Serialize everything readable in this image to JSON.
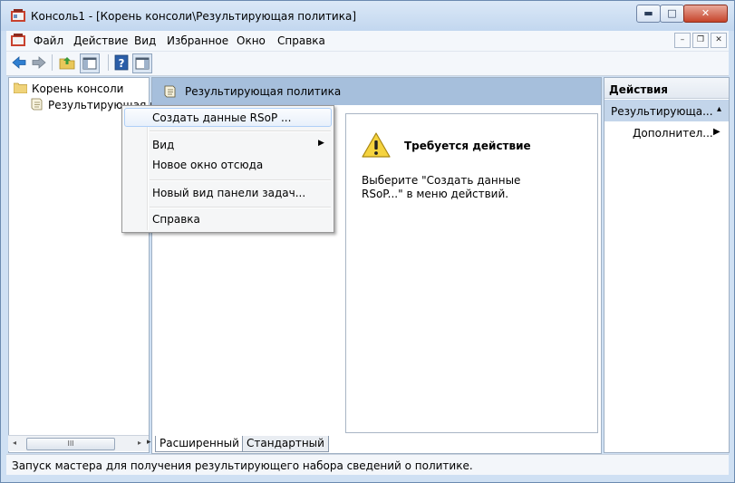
{
  "window": {
    "title": "Консоль1 - [Корень консоли\\Результирующая политика]",
    "minimize": "▬",
    "maximize": "□",
    "close": "✕"
  },
  "menu": {
    "items": [
      "Файл",
      "Действие",
      "Вид",
      "Избранное",
      "Окно",
      "Справка"
    ],
    "mdi_min": "–",
    "mdi_restore": "❐",
    "mdi_close": "✕"
  },
  "toolbar": {
    "icons": [
      "back-icon",
      "forward-icon",
      "up-folder-icon",
      "show-hide-tree-icon",
      "help-icon",
      "show-hide-action-pane-icon"
    ]
  },
  "tree": {
    "root": "Корень консоли",
    "child": "Результирующая п"
  },
  "scroll": {
    "thumb": "III",
    "left": "◂",
    "right": "▸"
  },
  "center": {
    "header": "Результирующая политика",
    "warning_title": "Требуется действие",
    "warning_text": "Выберите \"Создать данные RSoP...\" в меню действий."
  },
  "tabs": {
    "extended": "Расширенный",
    "standard": "Стандартный",
    "arrow": "▸"
  },
  "actions": {
    "header": "Действия",
    "section": "Результирующа...",
    "section_arrow": "▴",
    "more": "Дополнител...",
    "more_arrow": "▶"
  },
  "context_menu": {
    "create_rsop": "Создать данные RSoP ...",
    "view": "Вид",
    "view_arrow": "▶",
    "new_window": "Новое окно отсюда",
    "new_taskpad": "Новый вид панели задач...",
    "help": "Справка"
  },
  "status": {
    "text": "Запуск мастера для получения результирующего набора сведений о политике."
  },
  "colors": {
    "title_bg": "#c2d7ef",
    "header_bg": "#a6bfdc",
    "action_section_bg": "#c3d5ea",
    "close_btn": "#c6442b"
  }
}
